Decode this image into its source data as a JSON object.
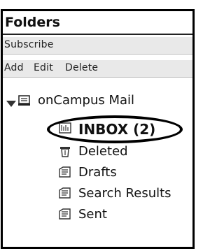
{
  "panel": {
    "title": "Folders",
    "subscribe": "Subscribe",
    "actions": [
      "Add",
      "Edit",
      "Delete"
    ]
  },
  "tree": {
    "account": {
      "label": "onCampus Mail",
      "icon": "mailbox-icon",
      "expanded": true
    },
    "folders": [
      {
        "label": "INBOX (2)",
        "icon": "inbox-icon",
        "selected": true
      },
      {
        "label": "Deleted",
        "icon": "trash-icon"
      },
      {
        "label": "Drafts",
        "icon": "drafts-icon"
      },
      {
        "label": "Search Results",
        "icon": "search-results-icon"
      },
      {
        "label": "Sent",
        "icon": "sent-icon"
      }
    ]
  },
  "colors": {
    "toolbar_bg": "#e9e9e9",
    "border": "#000000",
    "text": "#111111"
  }
}
